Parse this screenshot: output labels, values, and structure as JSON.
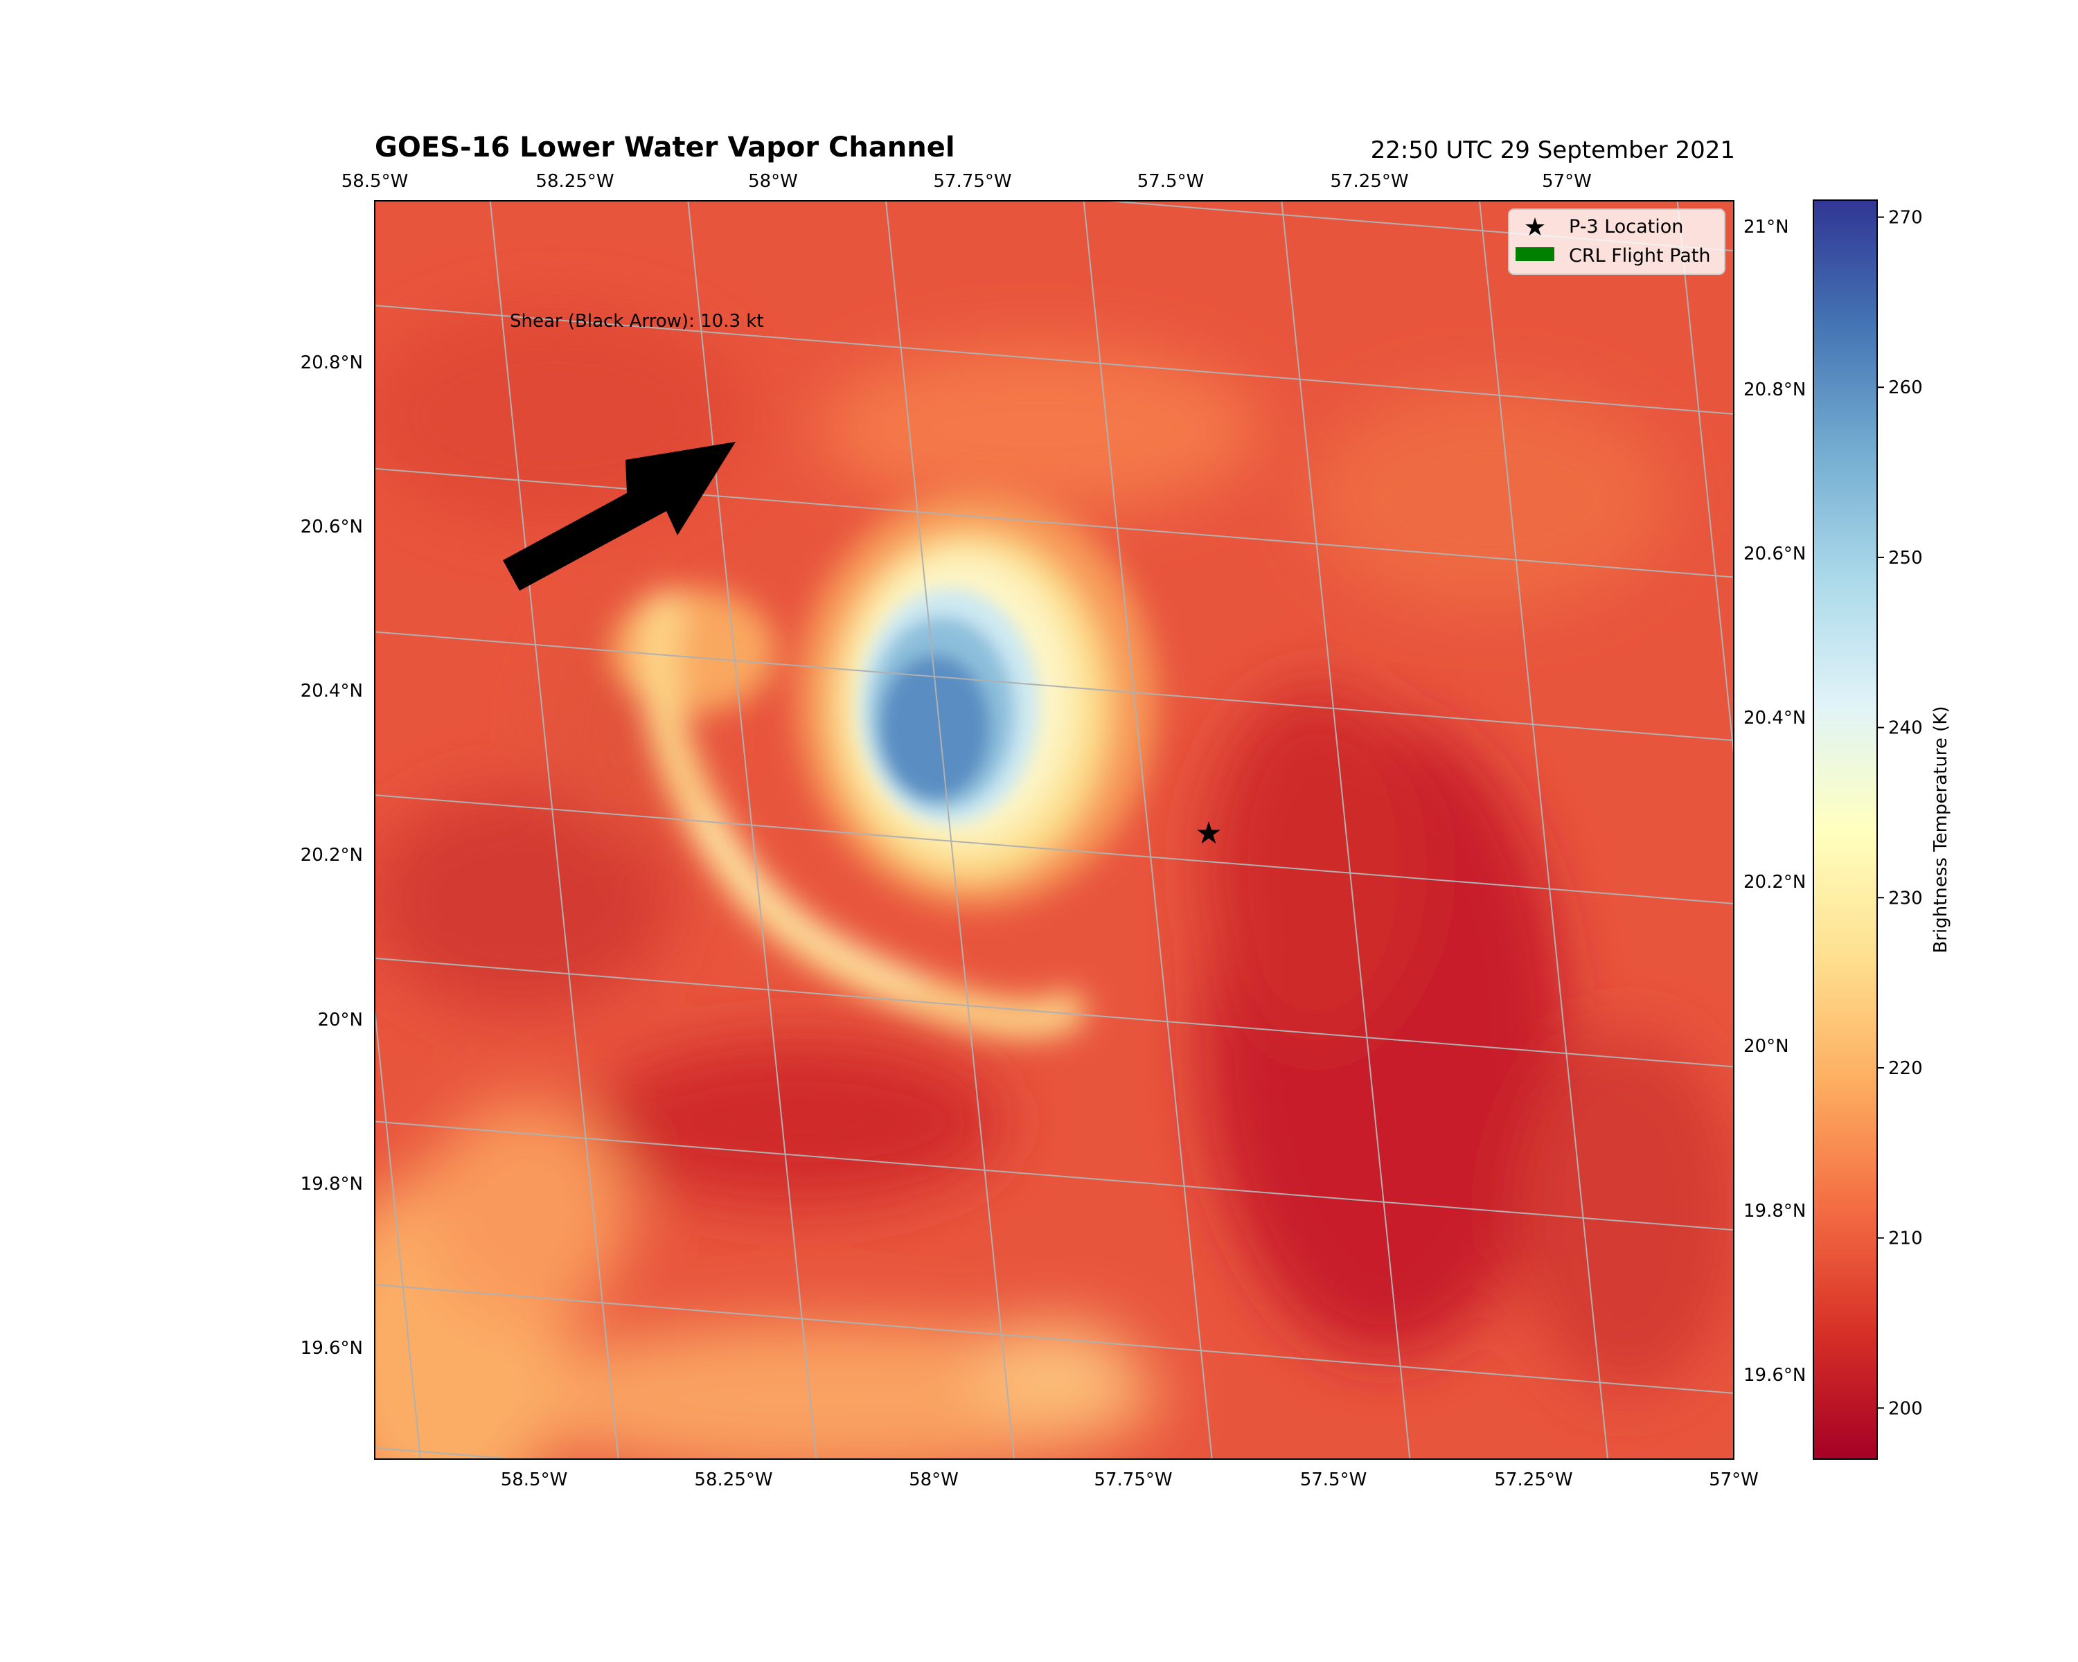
{
  "title": "GOES-16 Lower Water Vapor Channel",
  "timestamp": "22:50 UTC 29 September 2021",
  "annotation": "Shear (Black Arrow): 10.3 kt",
  "legend": [
    {
      "label": "P-3 Location",
      "symbol": "star",
      "color": "#000000"
    },
    {
      "label": "CRL Flight Path",
      "symbol": "patch",
      "color": "#008000"
    }
  ],
  "top_lon_ticks": [
    "58.5°W",
    "58.25°W",
    "58°W",
    "57.75°W",
    "57.5°W",
    "57.25°W",
    "57°W"
  ],
  "bottom_lon_ticks": [
    "58.5°W",
    "58.25°W",
    "58°W",
    "57.75°W",
    "57.5°W",
    "57.25°W",
    "57°W"
  ],
  "left_lat_ticks": [
    "20.8°N",
    "20.6°N",
    "20.4°N",
    "20.2°N",
    "20°N",
    "19.8°N",
    "19.6°N"
  ],
  "right_lat_ticks": [
    "21°N",
    "20.8°N",
    "20.6°N",
    "20.4°N",
    "20.2°N",
    "20°N",
    "19.8°N",
    "19.6°N"
  ],
  "colorbar": {
    "label": "Brightness Temperature (K)",
    "ticks": [
      200,
      210,
      220,
      230,
      240,
      250,
      260,
      270
    ],
    "min": 197,
    "max": 271,
    "colormap": [
      "#a50026",
      "#d73027",
      "#f46d43",
      "#fdae61",
      "#fee090",
      "#ffffbf",
      "#e0f3f8",
      "#abd9e9",
      "#74add1",
      "#4575b4",
      "#313695"
    ]
  },
  "p3_location": {
    "lon": -57.58,
    "lat": 20.28
  }
}
